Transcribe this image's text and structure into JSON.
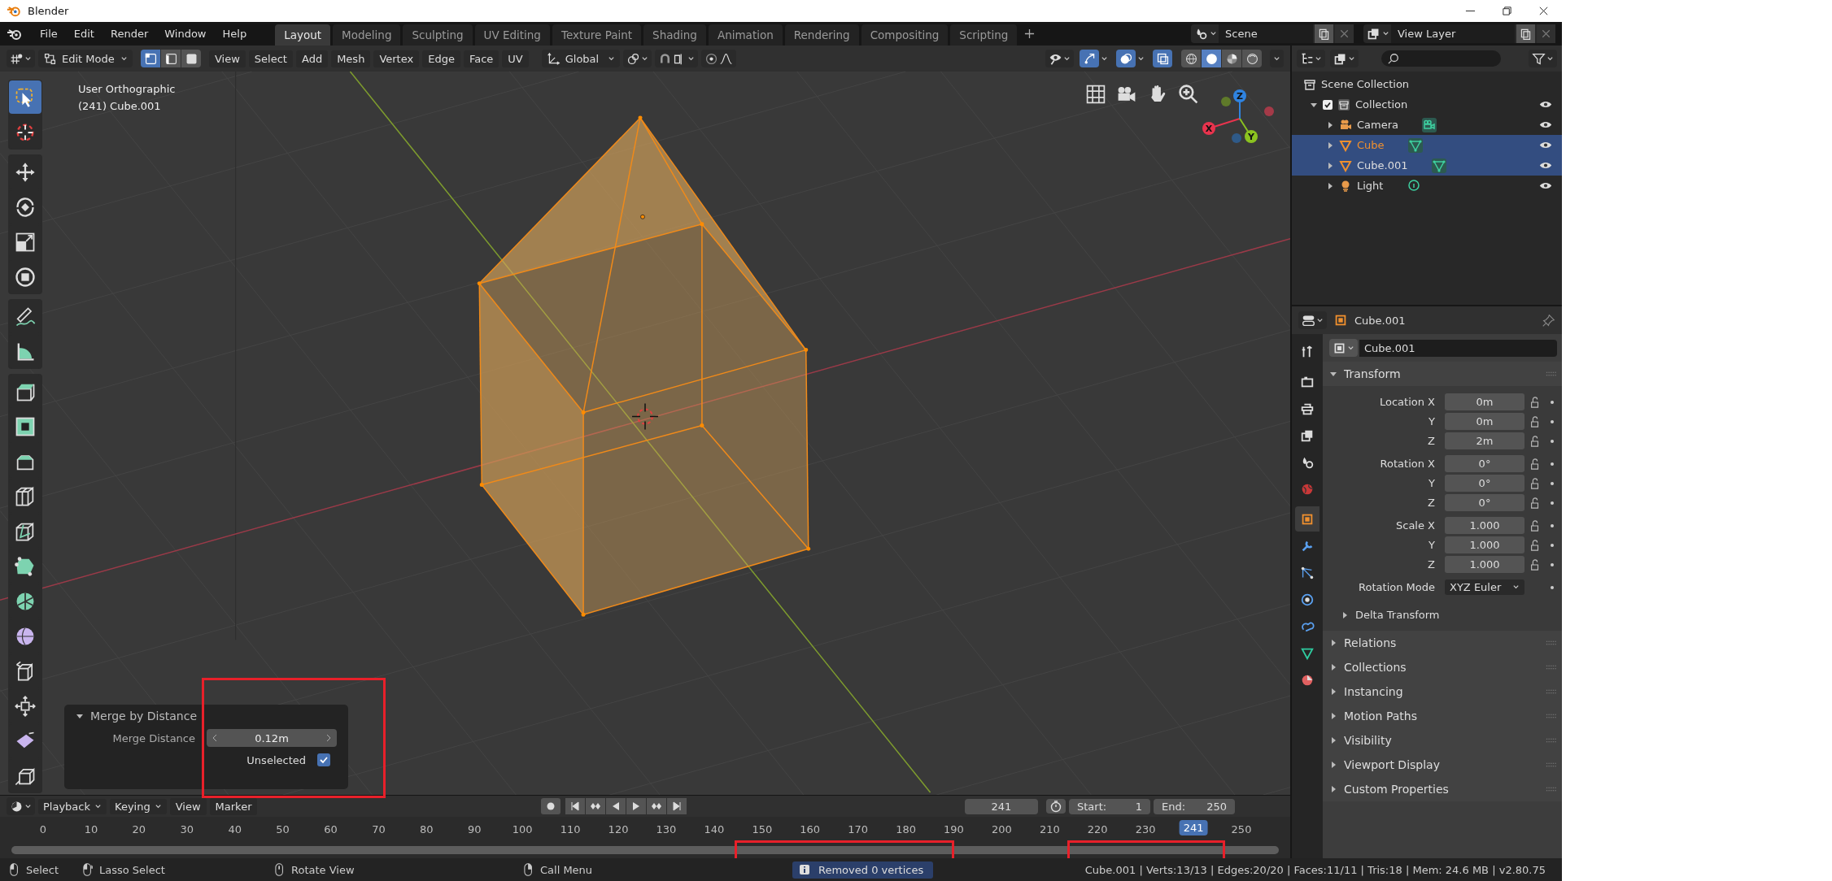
{
  "window": {
    "title": "Blender"
  },
  "menu": [
    "File",
    "Edit",
    "Render",
    "Window",
    "Help"
  ],
  "workspaces": [
    {
      "label": "Layout",
      "selected": true
    },
    {
      "label": "Modeling",
      "selected": false
    },
    {
      "label": "Sculpting",
      "selected": false
    },
    {
      "label": "UV Editing",
      "selected": false
    },
    {
      "label": "Texture Paint",
      "selected": false
    },
    {
      "label": "Shading",
      "selected": false
    },
    {
      "label": "Animation",
      "selected": false
    },
    {
      "label": "Rendering",
      "selected": false
    },
    {
      "label": "Compositing",
      "selected": false
    },
    {
      "label": "Scripting",
      "selected": false
    }
  ],
  "scene": {
    "name": "Scene"
  },
  "view_layer": {
    "name": "View Layer"
  },
  "viewport_header": {
    "mode": "Edit Mode",
    "select_modes": [
      {
        "kind": "vertex",
        "selected": true
      },
      {
        "kind": "edge",
        "selected": false
      },
      {
        "kind": "face",
        "selected": false
      }
    ],
    "menus": [
      "View",
      "Select",
      "Add",
      "Mesh",
      "Vertex",
      "Edge",
      "Face",
      "UV"
    ],
    "orientation": "Global",
    "toggles": [
      {
        "kind": "gizmo",
        "on": true
      },
      {
        "kind": "overlay",
        "on": true
      },
      {
        "kind": "xray",
        "on": true
      }
    ],
    "shading_modes": [
      {
        "kind": "wireframe",
        "selected": false
      },
      {
        "kind": "solid",
        "selected": true
      },
      {
        "kind": "material",
        "selected": false
      },
      {
        "kind": "rendered",
        "selected": false
      }
    ]
  },
  "viewport": {
    "view_name": "User Orthographic",
    "object_label": "(241) Cube.001",
    "tool_groups": [
      [
        {
          "kind": "select",
          "selected": true
        },
        {
          "kind": "cursor",
          "selected": false
        }
      ],
      [
        {
          "kind": "move",
          "selected": false
        },
        {
          "kind": "rotate",
          "selected": false
        },
        {
          "kind": "scale",
          "selected": false
        },
        {
          "kind": "transform",
          "selected": false
        }
      ],
      [
        {
          "kind": "annotate",
          "selected": false
        },
        {
          "kind": "measure",
          "selected": false
        }
      ],
      [
        {
          "kind": "extrude",
          "selected": false
        },
        {
          "kind": "inset",
          "selected": false
        },
        {
          "kind": "bevel",
          "selected": false
        },
        {
          "kind": "loopcut",
          "selected": false
        },
        {
          "kind": "knife",
          "selected": false
        },
        {
          "kind": "polybuild",
          "selected": false
        },
        {
          "kind": "spin",
          "selected": false
        },
        {
          "kind": "smooth",
          "selected": false
        },
        {
          "kind": "edgeslide",
          "selected": false
        },
        {
          "kind": "shrink",
          "selected": false
        },
        {
          "kind": "shear",
          "selected": false
        },
        {
          "kind": "rip",
          "selected": false
        }
      ]
    ],
    "gizmo_axes": [
      {
        "label": "X",
        "color": "#e8334d"
      },
      {
        "label": "Y",
        "color": "#8bc220"
      },
      {
        "label": "Z",
        "color": "#2f83e0"
      }
    ]
  },
  "operator_panel": {
    "title": "Merge by Distance",
    "expanded": true,
    "field_label": "Merge Distance",
    "value": "0.12m",
    "checkbox_label": "Unselected",
    "checked": true
  },
  "outliner": {
    "items": [
      {
        "name": "Scene Collection",
        "kind": "scene",
        "children": [
          {
            "name": "Collection",
            "kind": "collection",
            "expanded": true,
            "checked": true,
            "children": [
              {
                "name": "Camera",
                "kind": "camera",
                "expanded": false,
                "selected": false,
                "active": false
              },
              {
                "name": "Cube",
                "kind": "mesh",
                "expanded": false,
                "selected": true,
                "active": true
              },
              {
                "name": "Cube.001",
                "kind": "mesh",
                "expanded": false,
                "selected": true,
                "active": false
              },
              {
                "name": "Light",
                "kind": "light",
                "expanded": false,
                "selected": false,
                "active": false
              }
            ]
          }
        ]
      }
    ]
  },
  "properties": {
    "context": "Cube.001",
    "name_field": "Cube.001",
    "tabs": [
      {
        "kind": "tool",
        "selected": false
      },
      {
        "kind": "render",
        "selected": false
      },
      {
        "kind": "output",
        "selected": false
      },
      {
        "kind": "view_layer",
        "selected": false
      },
      {
        "kind": "scene",
        "selected": false
      },
      {
        "kind": "world",
        "selected": false
      },
      {
        "kind": "object",
        "selected": true
      },
      {
        "kind": "modifier",
        "selected": false
      },
      {
        "kind": "particles",
        "selected": false
      },
      {
        "kind": "physics",
        "selected": false
      },
      {
        "kind": "constraints",
        "selected": false
      },
      {
        "kind": "data",
        "selected": false
      },
      {
        "kind": "material",
        "selected": false
      }
    ],
    "transform": {
      "title": "Transform",
      "expanded": true,
      "groups": [
        [
          {
            "label": "Location X",
            "value": "0m"
          },
          {
            "label": "Y",
            "value": "0m"
          },
          {
            "label": "Z",
            "value": "2m"
          }
        ],
        [
          {
            "label": "Rotation X",
            "value": "0°"
          },
          {
            "label": "Y",
            "value": "0°"
          },
          {
            "label": "Z",
            "value": "0°"
          }
        ],
        [
          {
            "label": "Scale X",
            "value": "1.000"
          },
          {
            "label": "Y",
            "value": "1.000"
          },
          {
            "label": "Z",
            "value": "1.000"
          }
        ]
      ],
      "rotation_mode_label": "Rotation Mode",
      "rotation_mode": "XYZ Euler",
      "subpanel": {
        "title": "Delta Transform",
        "expanded": false
      }
    },
    "panels": [
      {
        "title": "Relations",
        "expanded": false
      },
      {
        "title": "Collections",
        "expanded": false
      },
      {
        "title": "Instancing",
        "expanded": false
      },
      {
        "title": "Motion Paths",
        "expanded": false
      },
      {
        "title": "Visibility",
        "expanded": false
      },
      {
        "title": "Viewport Display",
        "expanded": false
      },
      {
        "title": "Custom Properties",
        "expanded": false
      }
    ]
  },
  "timeline": {
    "menus": [
      {
        "label": "Playback",
        "kind": "dropdown"
      },
      {
        "label": "Keying",
        "kind": "dropdown"
      },
      {
        "label": "View",
        "kind": "menu"
      },
      {
        "label": "Marker",
        "kind": "menu"
      }
    ],
    "current_frame": "241",
    "start_label": "Start:",
    "start": "1",
    "end_label": "End:",
    "end": "250",
    "ruler": [
      {
        "kind": "frame",
        "label": "0"
      },
      {
        "kind": "frame",
        "label": "10"
      },
      {
        "kind": "frame",
        "label": "20"
      },
      {
        "kind": "frame",
        "label": "30"
      },
      {
        "kind": "frame",
        "label": "40"
      },
      {
        "kind": "frame",
        "label": "50"
      },
      {
        "kind": "frame",
        "label": "60"
      },
      {
        "kind": "frame",
        "label": "70"
      },
      {
        "kind": "frame",
        "label": "80"
      },
      {
        "kind": "frame",
        "label": "90"
      },
      {
        "kind": "frame",
        "label": "100"
      },
      {
        "kind": "frame",
        "label": "110"
      },
      {
        "kind": "frame",
        "label": "120"
      },
      {
        "kind": "frame",
        "label": "130"
      },
      {
        "kind": "frame",
        "label": "140"
      },
      {
        "kind": "frame",
        "label": "150"
      },
      {
        "kind": "frame",
        "label": "160"
      },
      {
        "kind": "frame",
        "label": "170"
      },
      {
        "kind": "frame",
        "label": "180"
      },
      {
        "kind": "frame",
        "label": "190"
      },
      {
        "kind": "frame",
        "label": "200"
      },
      {
        "kind": "frame",
        "label": "210"
      },
      {
        "kind": "frame",
        "label": "220"
      },
      {
        "kind": "frame",
        "label": "230"
      },
      {
        "kind": "current",
        "label": "241"
      },
      {
        "kind": "frame",
        "label": "250"
      }
    ]
  },
  "status_bar": {
    "hints": [
      {
        "kind": "left",
        "label": "Select"
      },
      {
        "kind": "drag",
        "label": "Lasso Select"
      },
      {
        "kind": "middle",
        "label": "Rotate View"
      },
      {
        "kind": "right",
        "label": "Call Menu"
      }
    ],
    "report": "Removed 0 vertices",
    "stats": "Cube.001 | Verts:13/13 | Edges:20/20 | Faces:11/11 | Tris:18 | Mem: 24.6 MB | v2.80.75"
  }
}
